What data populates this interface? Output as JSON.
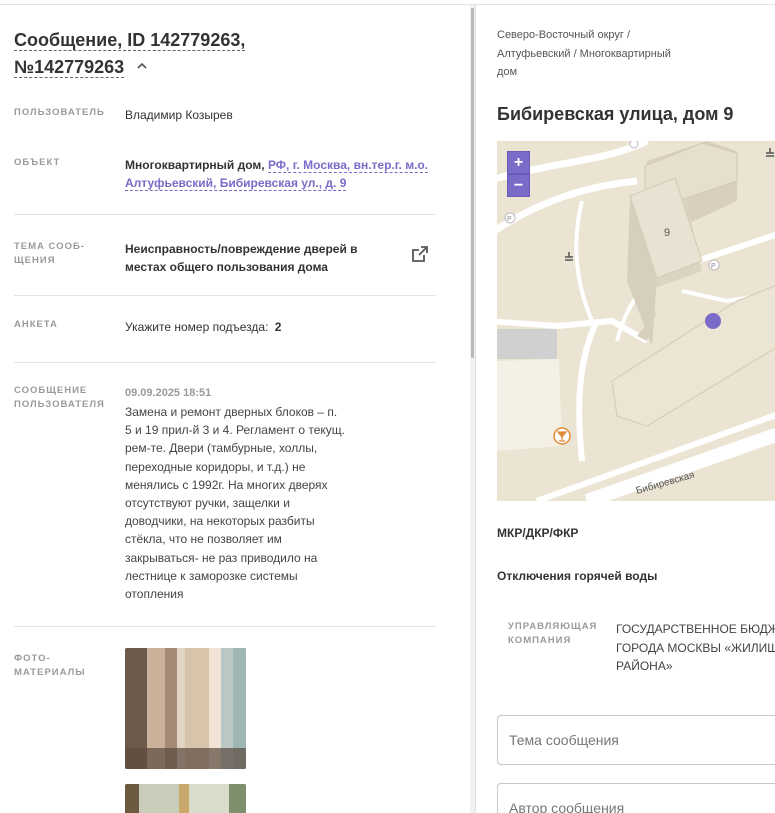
{
  "message": {
    "title": "Сообщение, ID 142779263, №142779263",
    "user_label": "ПОЛЬЗОВАТЕЛЬ",
    "user_value": "Владимир Козырев",
    "object_label": "ОБЪЕКТ",
    "object_type": "Многоквартирный дом,",
    "object_address_1": "РФ, г. Москва, вн.тер.г. м.о.",
    "object_address_2": "Алтуфьевский, Бибиревская ул., д. 9",
    "topic_label_1": "ТЕМА СООБ-",
    "topic_label_2": "ЩЕНИЯ",
    "topic_value_1": "Неисправность/повреждение дверей в",
    "topic_value_2": "местах общего пользования дома",
    "survey_label": "АНКЕТА",
    "survey_question": "Укажите номер подъезда:",
    "survey_answer": "2",
    "msg_label_1": "СООБЩЕНИЕ",
    "msg_label_2": "ПОЛЬЗОВАТЕЛЯ",
    "msg_date": "09.09.2025 18:51",
    "msg_lines": [
      "Замена и ремонт дверных блоков – п.",
      "5 и 19 прил-й 3 и 4. Регламент о текущ.",
      "рем-те. Двери (тамбурные, холлы,",
      "переходные коридоры, и т.д.) не",
      "менялись с 1992г. На многих дверях",
      "отсутствуют ручки, защелки и",
      "доводчики, на некоторых разбиты",
      "стёкла, что не позволяет им",
      "закрываться- не раз приводило на",
      "лестнице к заморозке системы",
      "отопления"
    ],
    "photos_label_1": "ФОТО-",
    "photos_label_2": "МАТЕРИАЛЫ"
  },
  "location": {
    "breadcrumb_1": "Северо-Восточный округ /",
    "breadcrumb_2": "Алтуфьевский / Многоквартирный",
    "breadcrumb_3": "дом",
    "address_title": "Бибиревская улица, дом 9",
    "map": {
      "zoom_in": "+",
      "zoom_out": "−",
      "building_number": "9",
      "street_label": "Бибиревская",
      "parking_label": "P"
    },
    "program_label": "МКР/ДКР/ФКР",
    "hot_water_label": "Отключения горячей воды",
    "uk_label_1": "УПРАВЛЯЮЩАЯ",
    "uk_label_2": "КОМПАНИЯ",
    "uk_value_1": "ГОСУДАРСТВЕННОЕ БЮДЖ",
    "uk_value_2": "ГОРОДА МОСКВЫ «ЖИЛИЩ",
    "uk_value_3": "РАЙОНА»",
    "topic_placeholder": "Тема сообщения",
    "author_placeholder": "Автор сообщения"
  },
  "colors": {
    "accent": "#7b6bc9",
    "map_bg": "#ece6d6"
  }
}
